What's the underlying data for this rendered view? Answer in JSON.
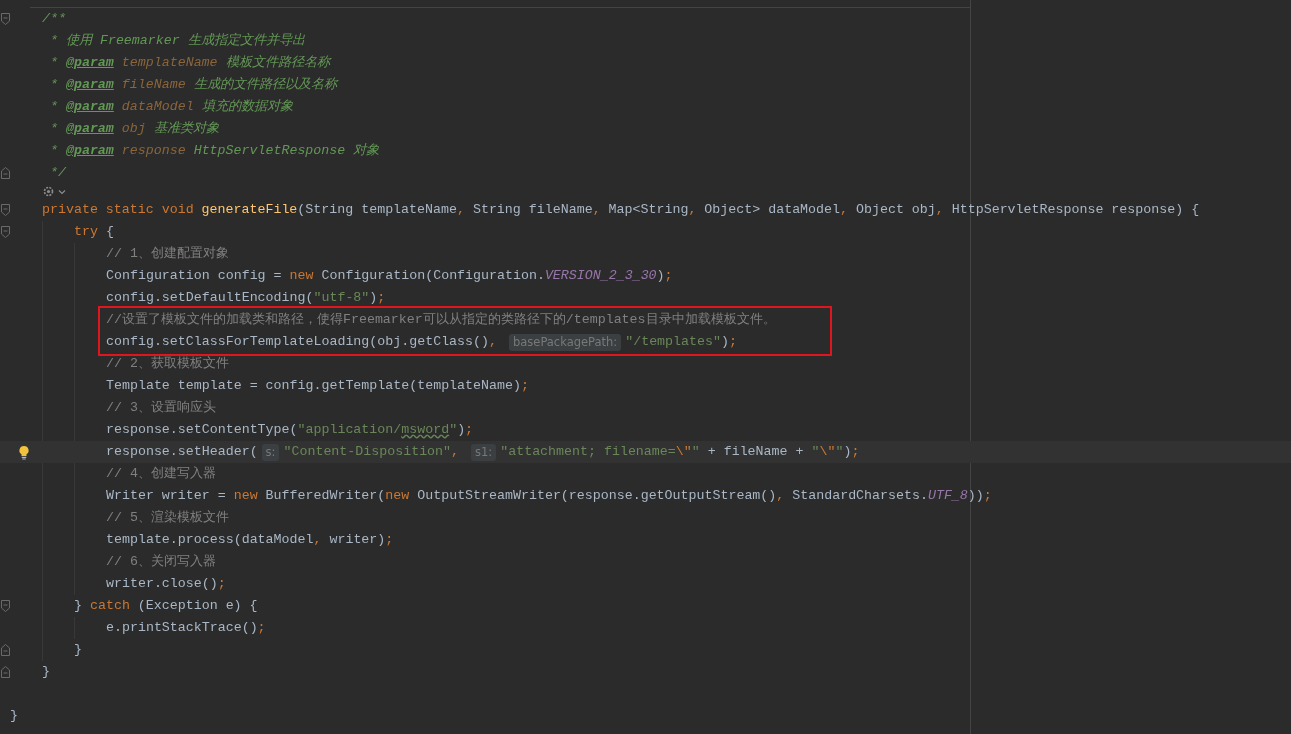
{
  "editor": {
    "lines": [
      {
        "kind": "block",
        "children": [
          {
            "kind": "code",
            "fold_open": true,
            "tokens": [
              {
                "kind": "doc",
                "text": "/**"
              }
            ]
          },
          {
            "kind": "code",
            "tokens": [
              {
                "kind": "doc",
                "text": " * 使用 Freemarker 生成指定文件并导出"
              }
            ]
          },
          {
            "kind": "code",
            "tokens": [
              {
                "kind": "doc",
                "text": " * "
              },
              {
                "kind": "tag",
                "text": "@param"
              },
              {
                "kind": "param",
                "text": " templateName"
              },
              {
                "kind": "doc",
                "text": " 模板文件路径名称"
              }
            ]
          },
          {
            "kind": "code",
            "tokens": [
              {
                "kind": "doc",
                "text": " * "
              },
              {
                "kind": "tag",
                "text": "@param"
              },
              {
                "kind": "param",
                "text": " fileName"
              },
              {
                "kind": "doc",
                "text": " 生成的文件路径以及名称"
              }
            ]
          },
          {
            "kind": "code",
            "tokens": [
              {
                "kind": "doc",
                "text": " * "
              },
              {
                "kind": "tag",
                "text": "@param"
              },
              {
                "kind": "param",
                "text": " dataModel"
              },
              {
                "kind": "doc",
                "text": " 填充的数据对象"
              }
            ]
          },
          {
            "kind": "code",
            "tokens": [
              {
                "kind": "doc",
                "text": " * "
              },
              {
                "kind": "tag",
                "text": "@param"
              },
              {
                "kind": "param",
                "text": " obj"
              },
              {
                "kind": "doc",
                "text": " 基准类对象"
              }
            ]
          },
          {
            "kind": "code",
            "tokens": [
              {
                "kind": "doc",
                "text": " * "
              },
              {
                "kind": "tag",
                "text": "@param"
              },
              {
                "kind": "param",
                "text": " response"
              },
              {
                "kind": "doc",
                "text": " HttpServletResponse 对象"
              }
            ]
          },
          {
            "kind": "code",
            "fold_close": true,
            "tokens": [
              {
                "kind": "doc",
                "text": " */"
              }
            ]
          },
          {
            "kind": "icons"
          },
          {
            "kind": "code",
            "fold_open": true,
            "tokens": [
              {
                "kind": "kw",
                "text": "private static void "
              },
              {
                "kind": "method",
                "text": "generateFile"
              },
              {
                "kind": "plain",
                "text": "(String templateName"
              },
              {
                "kind": "punct",
                "text": ", "
              },
              {
                "kind": "plain",
                "text": "String fileName"
              },
              {
                "kind": "punct",
                "text": ", "
              },
              {
                "kind": "plain",
                "text": "Map<String"
              },
              {
                "kind": "punct",
                "text": ", "
              },
              {
                "kind": "plain",
                "text": "Object> dataModel"
              },
              {
                "kind": "punct",
                "text": ", "
              },
              {
                "kind": "plain",
                "text": "Object obj"
              },
              {
                "kind": "punct",
                "text": ", "
              },
              {
                "kind": "plain",
                "text": "HttpServletResponse response) {"
              }
            ],
            "children": [
              {
                "kind": "code",
                "fold_open": true,
                "tokens": [
                  {
                    "kind": "kw",
                    "text": "try"
                  },
                  {
                    "kind": "plain",
                    "text": " {"
                  }
                ],
                "children": [
                  {
                    "kind": "code",
                    "tokens": [
                      {
                        "kind": "comment",
                        "text": "// 1、创建配置对象"
                      }
                    ]
                  },
                  {
                    "kind": "code",
                    "tokens": [
                      {
                        "kind": "plain",
                        "text": "Configuration config = "
                      },
                      {
                        "kind": "kw",
                        "text": "new"
                      },
                      {
                        "kind": "plain",
                        "text": " Configuration(Configuration."
                      },
                      {
                        "kind": "const",
                        "text": "VERSION_2_3_30"
                      },
                      {
                        "kind": "plain",
                        "text": ")"
                      },
                      {
                        "kind": "punct",
                        "text": ";"
                      }
                    ]
                  },
                  {
                    "kind": "code",
                    "tokens": [
                      {
                        "kind": "plain",
                        "text": "config.setDefaultEncoding("
                      },
                      {
                        "kind": "str",
                        "text": "\"utf-8\""
                      },
                      {
                        "kind": "plain",
                        "text": ")"
                      },
                      {
                        "kind": "punct",
                        "text": ";"
                      }
                    ]
                  },
                  {
                    "kind": "code",
                    "boxed": true,
                    "tokens": [
                      {
                        "kind": "comment",
                        "text": "//设置了模板文件的加载类和路径，使得Freemarker可以从指定的类路径下的/templates目录中加载模板文件。"
                      }
                    ]
                  },
                  {
                    "kind": "code",
                    "boxed": true,
                    "tokens": [
                      {
                        "kind": "plain",
                        "text": "config.setClassForTemplateLoading(obj.getClass()"
                      },
                      {
                        "kind": "punct",
                        "text": ", "
                      },
                      {
                        "kind": "hint",
                        "text": "basePackagePath:"
                      },
                      {
                        "kind": "str",
                        "text": "\"/templates\""
                      },
                      {
                        "kind": "plain",
                        "text": ")"
                      },
                      {
                        "kind": "punct",
                        "text": ";"
                      }
                    ]
                  },
                  {
                    "kind": "code",
                    "tokens": [
                      {
                        "kind": "comment",
                        "text": "// 2、获取模板文件"
                      }
                    ]
                  },
                  {
                    "kind": "code",
                    "tokens": [
                      {
                        "kind": "plain",
                        "text": "Template template = config.getTemplate(templateName)"
                      },
                      {
                        "kind": "punct",
                        "text": ";"
                      }
                    ]
                  },
                  {
                    "kind": "code",
                    "tokens": [
                      {
                        "kind": "comment",
                        "text": "// 3、设置响应头"
                      }
                    ]
                  },
                  {
                    "kind": "code",
                    "tokens": [
                      {
                        "kind": "plain",
                        "text": "response.setContentType("
                      },
                      {
                        "kind": "str",
                        "text": "\"application/"
                      },
                      {
                        "kind": "typo",
                        "text": "msword"
                      },
                      {
                        "kind": "str",
                        "text": "\""
                      },
                      {
                        "kind": "plain",
                        "text": ")"
                      },
                      {
                        "kind": "punct",
                        "text": ";"
                      }
                    ]
                  },
                  {
                    "kind": "code",
                    "current": true,
                    "bulb": true,
                    "tokens": [
                      {
                        "kind": "plain",
                        "text": "response.setHeader("
                      },
                      {
                        "kind": "hint",
                        "text": "s:"
                      },
                      {
                        "kind": "str",
                        "text": "\"Content-Disposition\""
                      },
                      {
                        "kind": "punct",
                        "text": ", "
                      },
                      {
                        "kind": "hint",
                        "text": "s1:"
                      },
                      {
                        "kind": "str",
                        "text": "\"attachment; filename="
                      },
                      {
                        "kind": "esc",
                        "text": "\\\""
                      },
                      {
                        "kind": "str",
                        "text": "\""
                      },
                      {
                        "kind": "plain",
                        "text": " + fileName + "
                      },
                      {
                        "kind": "str",
                        "text": "\""
                      },
                      {
                        "kind": "esc",
                        "text": "\\\""
                      },
                      {
                        "kind": "str",
                        "text": "\""
                      },
                      {
                        "kind": "plain",
                        "text": ")"
                      },
                      {
                        "kind": "punct",
                        "text": ";"
                      }
                    ]
                  },
                  {
                    "kind": "code",
                    "tokens": [
                      {
                        "kind": "comment",
                        "text": "// 4、创建写入器"
                      }
                    ]
                  },
                  {
                    "kind": "code",
                    "tokens": [
                      {
                        "kind": "plain",
                        "text": "Writer writer = "
                      },
                      {
                        "kind": "kw",
                        "text": "new"
                      },
                      {
                        "kind": "plain",
                        "text": " BufferedWriter("
                      },
                      {
                        "kind": "kw",
                        "text": "new"
                      },
                      {
                        "kind": "plain",
                        "text": " OutputStreamWriter(response.getOutputStream()"
                      },
                      {
                        "kind": "punct",
                        "text": ", "
                      },
                      {
                        "kind": "plain",
                        "text": "StandardCharsets."
                      },
                      {
                        "kind": "const",
                        "text": "UTF_8"
                      },
                      {
                        "kind": "plain",
                        "text": "))"
                      },
                      {
                        "kind": "punct",
                        "text": ";"
                      }
                    ]
                  },
                  {
                    "kind": "code",
                    "tokens": [
                      {
                        "kind": "comment",
                        "text": "// 5、渲染模板文件"
                      }
                    ]
                  },
                  {
                    "kind": "code",
                    "tokens": [
                      {
                        "kind": "plain",
                        "text": "template.process(dataModel"
                      },
                      {
                        "kind": "punct",
                        "text": ", "
                      },
                      {
                        "kind": "plain",
                        "text": "writer)"
                      },
                      {
                        "kind": "punct",
                        "text": ";"
                      }
                    ]
                  },
                  {
                    "kind": "code",
                    "tokens": [
                      {
                        "kind": "comment",
                        "text": "// 6、关闭写入器"
                      }
                    ]
                  },
                  {
                    "kind": "code",
                    "tokens": [
                      {
                        "kind": "plain",
                        "text": "writer.close()"
                      },
                      {
                        "kind": "punct",
                        "text": ";"
                      }
                    ]
                  }
                ]
              },
              {
                "kind": "code",
                "fold_open": true,
                "tokens": [
                  {
                    "kind": "plain",
                    "text": "} "
                  },
                  {
                    "kind": "kw",
                    "text": "catch"
                  },
                  {
                    "kind": "plain",
                    "text": " (Exception e) {"
                  }
                ],
                "children": [
                  {
                    "kind": "code",
                    "tokens": [
                      {
                        "kind": "plain",
                        "text": "e.printStackTrace()"
                      },
                      {
                        "kind": "punct",
                        "text": ";"
                      }
                    ]
                  }
                ]
              },
              {
                "kind": "code",
                "fold_close": true,
                "tokens": [
                  {
                    "kind": "plain",
                    "text": "}"
                  }
                ]
              }
            ]
          },
          {
            "kind": "code",
            "fold_close": true,
            "tokens": [
              {
                "kind": "plain",
                "text": "}"
              }
            ]
          }
        ]
      },
      {
        "kind": "blank"
      },
      {
        "kind": "code",
        "tokens": [
          {
            "kind": "plain",
            "text": "}"
          }
        ]
      }
    ]
  }
}
